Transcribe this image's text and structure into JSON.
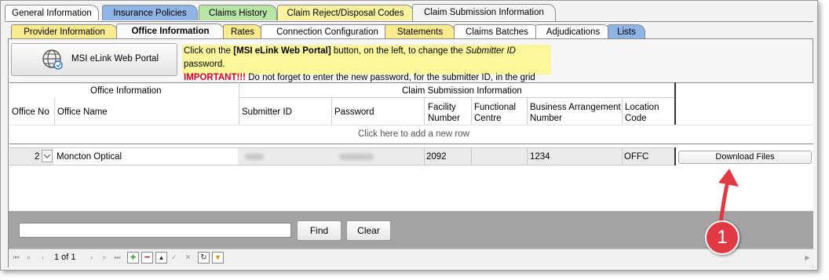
{
  "tabs_top": [
    {
      "label": "General Information",
      "color": "#ffffff"
    },
    {
      "label": "Insurance Policies",
      "color": "#8fb4e6"
    },
    {
      "label": "Claims History",
      "color": "#b9e6a7"
    },
    {
      "label": "Claim Reject/Disposal Codes",
      "color": "#fbf3a0"
    },
    {
      "label": "Claim Submission Information",
      "color": "#f5f5f5",
      "active": true
    }
  ],
  "tabs_sub": [
    {
      "label": "Provider Information",
      "color": "#fbeb8f"
    },
    {
      "label": "Office Information",
      "color": "#fafafa",
      "active": true
    },
    {
      "label": "Rates",
      "color": "#fbeb8f"
    },
    {
      "label": "Connection Configuration",
      "color": "#ffffff"
    },
    {
      "label": "Statements",
      "color": "#fbeb8f"
    },
    {
      "label": "Claims Batches",
      "color": "#ffffff"
    },
    {
      "label": "Adjudications",
      "color": "#ffffff"
    },
    {
      "label": "Lists",
      "color": "#8fb4e6"
    }
  ],
  "portal_button": {
    "label": "MSI eLink Web Portal",
    "icon": "globe-icon"
  },
  "notice": {
    "line1_a": "Click on the ",
    "line1_b": "[MSI eLink Web Portal]",
    "line1_c": " button, on the left, to change the ",
    "line1_d": "Submitter ID",
    "line1_e": " password.",
    "line2_a": "IMPORTANT!!!",
    "line2_b": " Do not forget to enter the new password, for the submitter ID, in the grid below.",
    "bg": "#fbf79a"
  },
  "grid": {
    "group1": "Office Information",
    "group2": "Claim Submission Information",
    "columns": {
      "office_no": "Office No",
      "office_name": "Office Name",
      "submitter_id": "Submitter ID",
      "password": "Password",
      "facility_1": "Facility",
      "facility_2": "Number",
      "functional_1": "Functional",
      "functional_2": "Centre",
      "business_1": "Business Arrangement",
      "business_2": "Number",
      "location_1": "Location",
      "location_2": "Code"
    },
    "add_row": "Click here to add a new row",
    "row": {
      "office_no": "2",
      "office_name": "Moncton Optical",
      "facility_number": "2092",
      "functional_centre": "",
      "business_number": "1234",
      "location_code": "OFFC",
      "download_label": "Download Files"
    }
  },
  "find": {
    "placeholder": "",
    "find_label": "Find",
    "clear_label": "Clear"
  },
  "pager": {
    "page_text": "1 of 1"
  },
  "marker": {
    "label": "1",
    "color": "#e23a44"
  }
}
